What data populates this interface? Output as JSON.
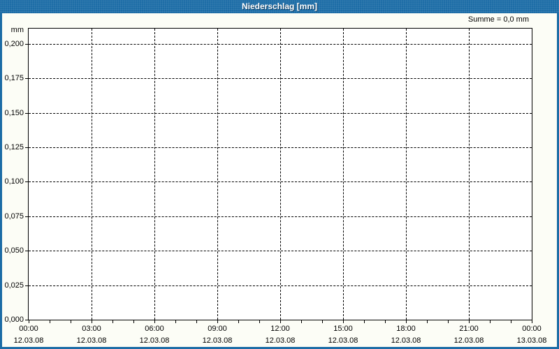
{
  "window": {
    "title": "Niederschlag [mm]"
  },
  "header": {
    "summe_label": "Summe = 0,0 mm"
  },
  "colors": {
    "frame_blue": "#1c6ca6",
    "title_shadow": "#0d3a5e",
    "outer_background": "#fcfdf6",
    "plot_background": "#ffffff",
    "grid_color": "#000000"
  },
  "chart_data": {
    "type": "line",
    "title": "Niederschlag [mm]",
    "ylabel": "mm",
    "xlabel": "",
    "grid": "dashed",
    "legend": "none",
    "ylim": [
      0,
      0.211
    ],
    "x_range_hours": [
      0,
      24
    ],
    "x_minor_step_hours": 1,
    "y_ticks": [
      {
        "value": 0.2,
        "label": "0,200"
      },
      {
        "value": 0.175,
        "label": "0,175"
      },
      {
        "value": 0.15,
        "label": "0,150"
      },
      {
        "value": 0.125,
        "label": "0,125"
      },
      {
        "value": 0.1,
        "label": "0,100"
      },
      {
        "value": 0.075,
        "label": "0,075"
      },
      {
        "value": 0.05,
        "label": "0,050"
      },
      {
        "value": 0.025,
        "label": "0,025"
      },
      {
        "value": 0.0,
        "label": "0,000"
      }
    ],
    "x_major_ticks": [
      {
        "hour": 0,
        "time": "00:00",
        "date": "12.03.08"
      },
      {
        "hour": 3,
        "time": "03:00",
        "date": "12.03.08"
      },
      {
        "hour": 6,
        "time": "06:00",
        "date": "12.03.08"
      },
      {
        "hour": 9,
        "time": "09:00",
        "date": "12.03.08"
      },
      {
        "hour": 12,
        "time": "12:00",
        "date": "12.03.08"
      },
      {
        "hour": 15,
        "time": "15:00",
        "date": "12.03.08"
      },
      {
        "hour": 18,
        "time": "18:00",
        "date": "12.03.08"
      },
      {
        "hour": 21,
        "time": "21:00",
        "date": "12.03.08"
      },
      {
        "hour": 24,
        "time": "00:00",
        "date": "13.03.08"
      }
    ],
    "series": [
      {
        "name": "Niederschlag",
        "values": []
      }
    ],
    "annotations": [
      "Summe = 0,0 mm"
    ]
  }
}
